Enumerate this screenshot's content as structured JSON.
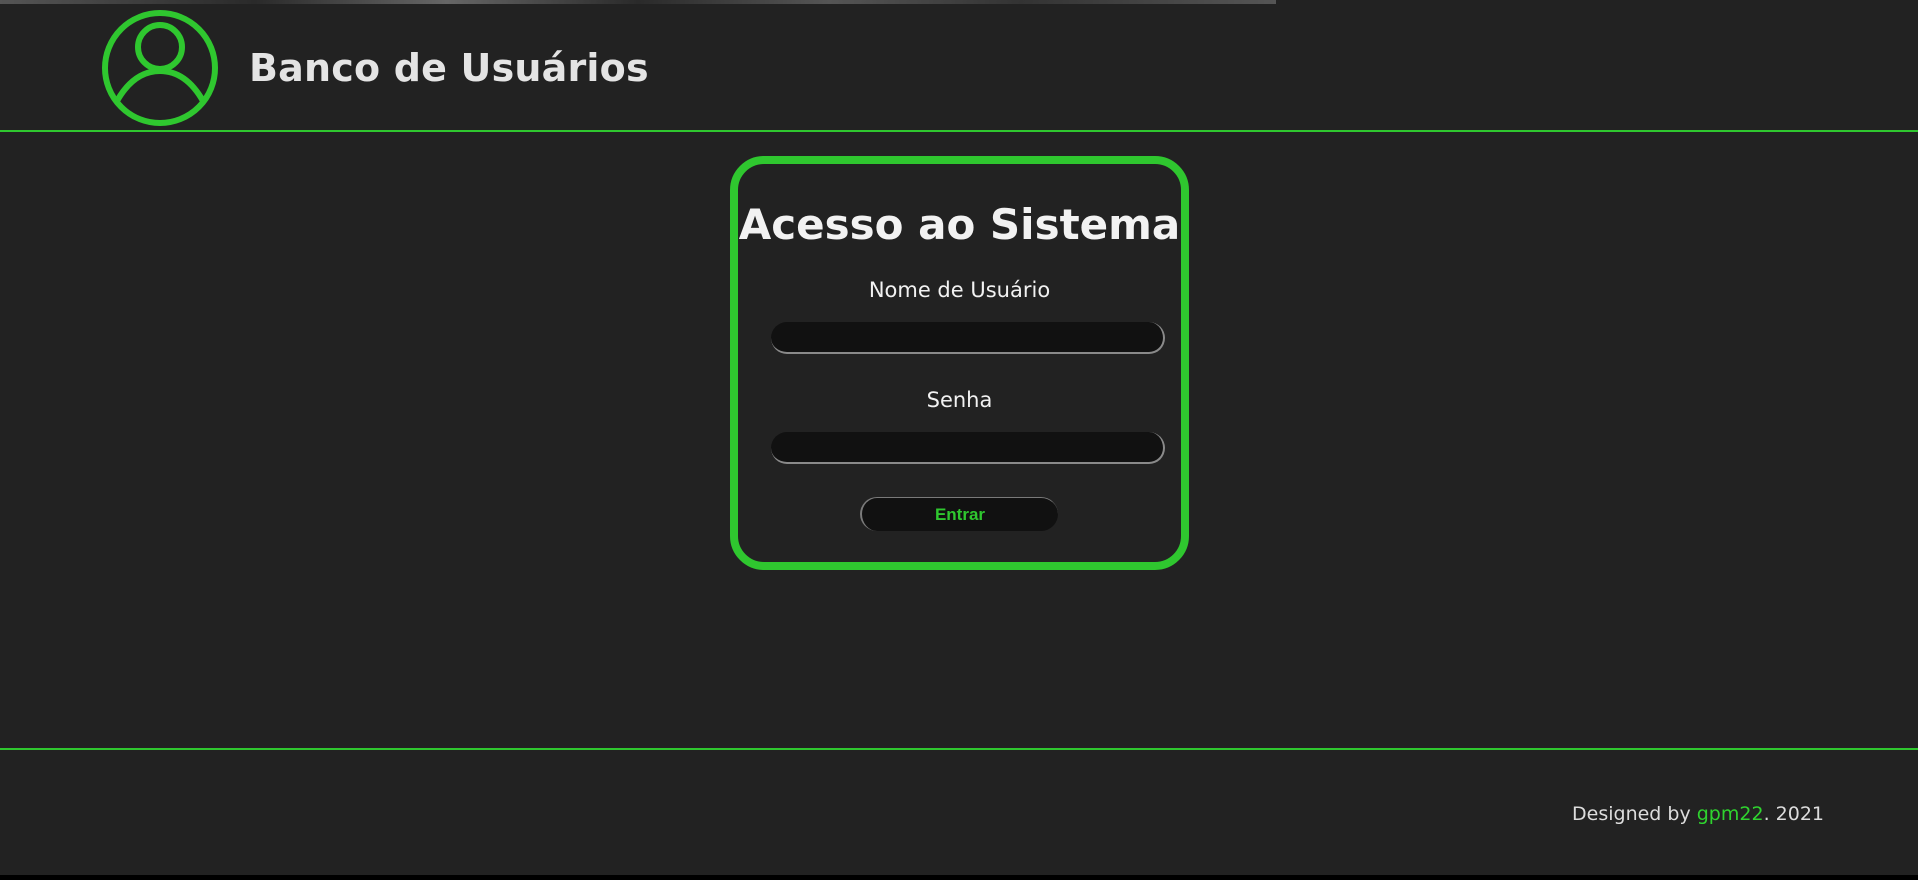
{
  "header": {
    "title": "Banco de Usuários",
    "icon": "user-circle-icon"
  },
  "login": {
    "title": "Acesso ao Sistema",
    "username_label": "Nome de Usuário",
    "username_value": "",
    "password_label": "Senha",
    "password_value": "",
    "submit_label": "Entrar"
  },
  "footer": {
    "prefix": "Designed by ",
    "author_link": "gpm22",
    "suffix": ". 2021"
  },
  "colors": {
    "accent": "#2fc72f",
    "background": "#222222",
    "input_background": "#111111",
    "text": "#f2f2f2"
  }
}
